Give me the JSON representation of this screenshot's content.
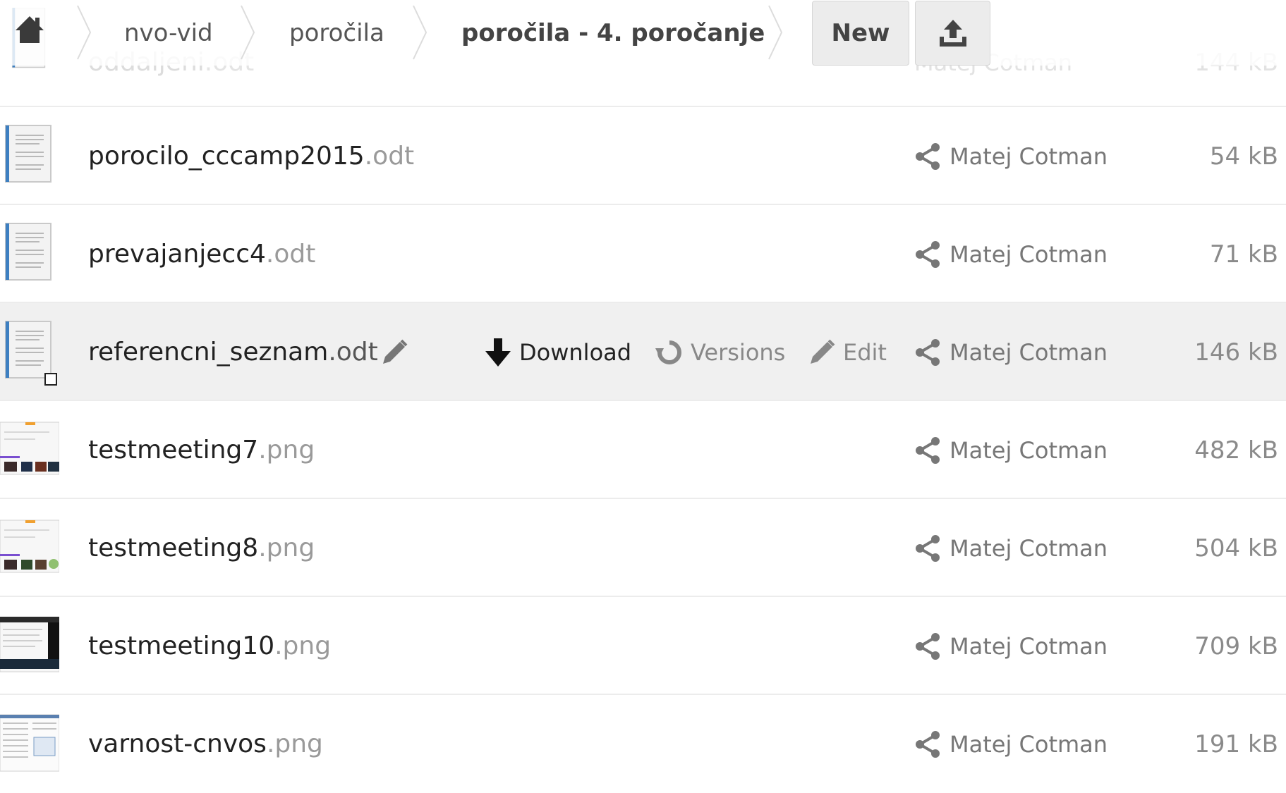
{
  "breadcrumb": {
    "items": [
      {
        "label": "nvo-vid"
      },
      {
        "label": "poročila"
      },
      {
        "label": "poročila - 4. poročanje"
      }
    ],
    "new_label": "New"
  },
  "files": [
    {
      "name": "oddaljeni",
      "ext": ".odt",
      "owner": "Matej Cotman",
      "size": "144 kB",
      "kind": "doc"
    },
    {
      "name": "porocilo_cccamp2015",
      "ext": ".odt",
      "owner": "Matej Cotman",
      "size": "54 kB",
      "kind": "doc"
    },
    {
      "name": "prevajanjecc4",
      "ext": ".odt",
      "owner": "Matej Cotman",
      "size": "71 kB",
      "kind": "doc"
    },
    {
      "name": "referencni_seznam",
      "ext": ".odt",
      "owner": "Matej Cotman",
      "size": "146 kB",
      "kind": "doc"
    },
    {
      "name": "testmeeting7",
      "ext": ".png",
      "owner": "Matej Cotman",
      "size": "482 kB",
      "kind": "img"
    },
    {
      "name": "testmeeting8",
      "ext": ".png",
      "owner": "Matej Cotman",
      "size": "504 kB",
      "kind": "img"
    },
    {
      "name": "testmeeting10",
      "ext": ".png",
      "owner": "Matej Cotman",
      "size": "709 kB",
      "kind": "img-dark"
    },
    {
      "name": "varnost-cnvos",
      "ext": ".png",
      "owner": "Matej Cotman",
      "size": "191 kB",
      "kind": "img-text"
    }
  ],
  "actions": {
    "download": "Download",
    "versions": "Versions",
    "edit": "Edit"
  }
}
